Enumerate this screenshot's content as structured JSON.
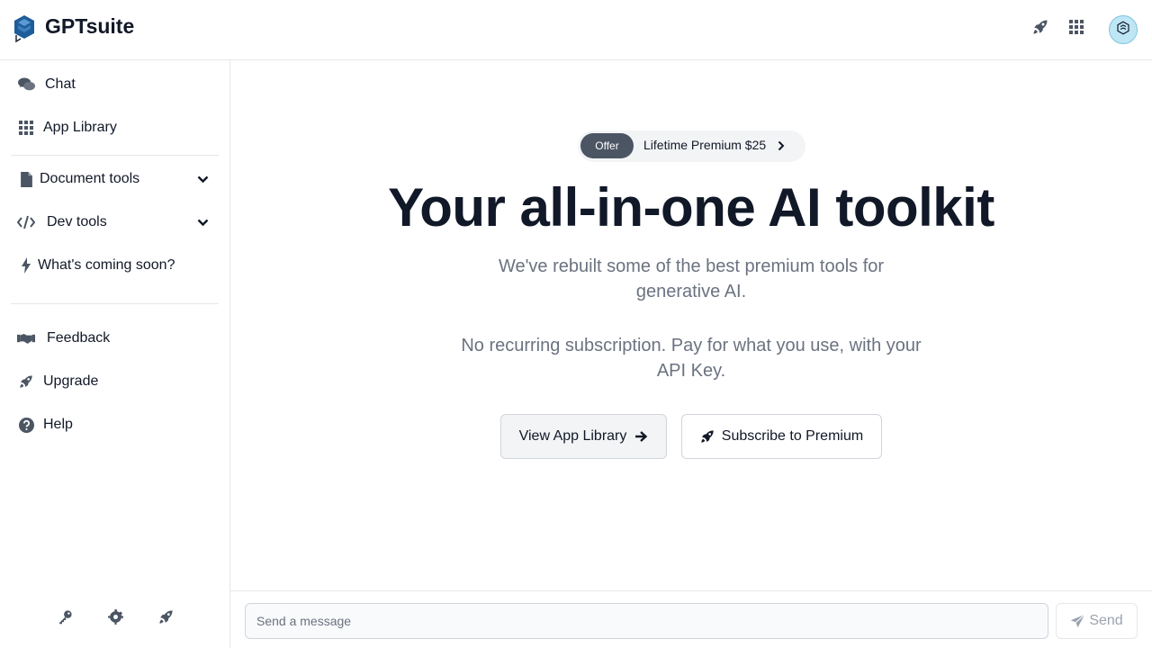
{
  "app": {
    "name": "GPTsuite"
  },
  "header": {
    "icons": [
      "rocket-icon",
      "grid-icon"
    ],
    "avatar_icon": "avatar-icon"
  },
  "sidebar": {
    "items": [
      {
        "label": "Chat",
        "icon": "chat-icon"
      },
      {
        "label": "App Library",
        "icon": "grid-icon"
      },
      {
        "label": "Document tools",
        "icon": "document-icon",
        "expandable": true
      },
      {
        "label": "Dev tools",
        "icon": "code-icon",
        "expandable": true
      },
      {
        "label": "What's coming soon?",
        "icon": "bolt-icon"
      },
      {
        "label": "Feedback",
        "icon": "handshake-icon"
      },
      {
        "label": "Upgrade",
        "icon": "rocket-icon"
      },
      {
        "label": "Help",
        "icon": "help-icon"
      }
    ],
    "footer_icons": [
      "key-icon",
      "gear-icon",
      "rocket-icon"
    ]
  },
  "main": {
    "offer": {
      "badge": "Offer",
      "text": "Lifetime Premium $25"
    },
    "title": "Your all-in-one AI toolkit",
    "subtitle_1": "We've rebuilt some of the best premium tools for generative AI.",
    "subtitle_2": "No recurring subscription. Pay for what you use, with your API Key.",
    "buttons": {
      "library": "View App Library",
      "premium": "Subscribe to Premium"
    }
  },
  "composer": {
    "placeholder": "Send a message",
    "value": "",
    "send_label": "Send"
  },
  "colors": {
    "logo": "#1f5d99",
    "text": "#111827",
    "muted": "#6b7280",
    "icon": "#4b5563",
    "badge": "#4b5563"
  }
}
